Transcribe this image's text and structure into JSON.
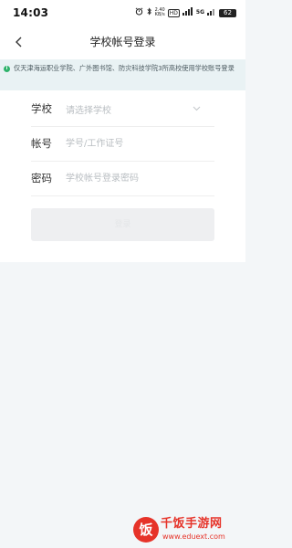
{
  "status_bar": {
    "time": "14:03",
    "speed": "2.40\nKB/s",
    "hd_label": "HD",
    "signal_label": "5G",
    "battery": "62"
  },
  "nav": {
    "title": "学校帐号登录"
  },
  "notice": {
    "text": "仅天津海运职业学院、广外图书馆、防灾科技学院3所高校使用学校账号登录"
  },
  "form": {
    "school_label": "学校",
    "school_placeholder": "请选择学校",
    "account_label": "帐号",
    "account_placeholder": "学号/工作证号",
    "password_label": "密码",
    "password_placeholder": "学校帐号登录密码",
    "login_button": "登录"
  },
  "watermark": {
    "logo_char": "饭",
    "brand": "千饭手游网",
    "url": "www.eduext.com"
  },
  "colors": {
    "accent_green": "#2fb36b",
    "notice_bg": "#e9f2f4",
    "watermark_red": "#e63329"
  }
}
